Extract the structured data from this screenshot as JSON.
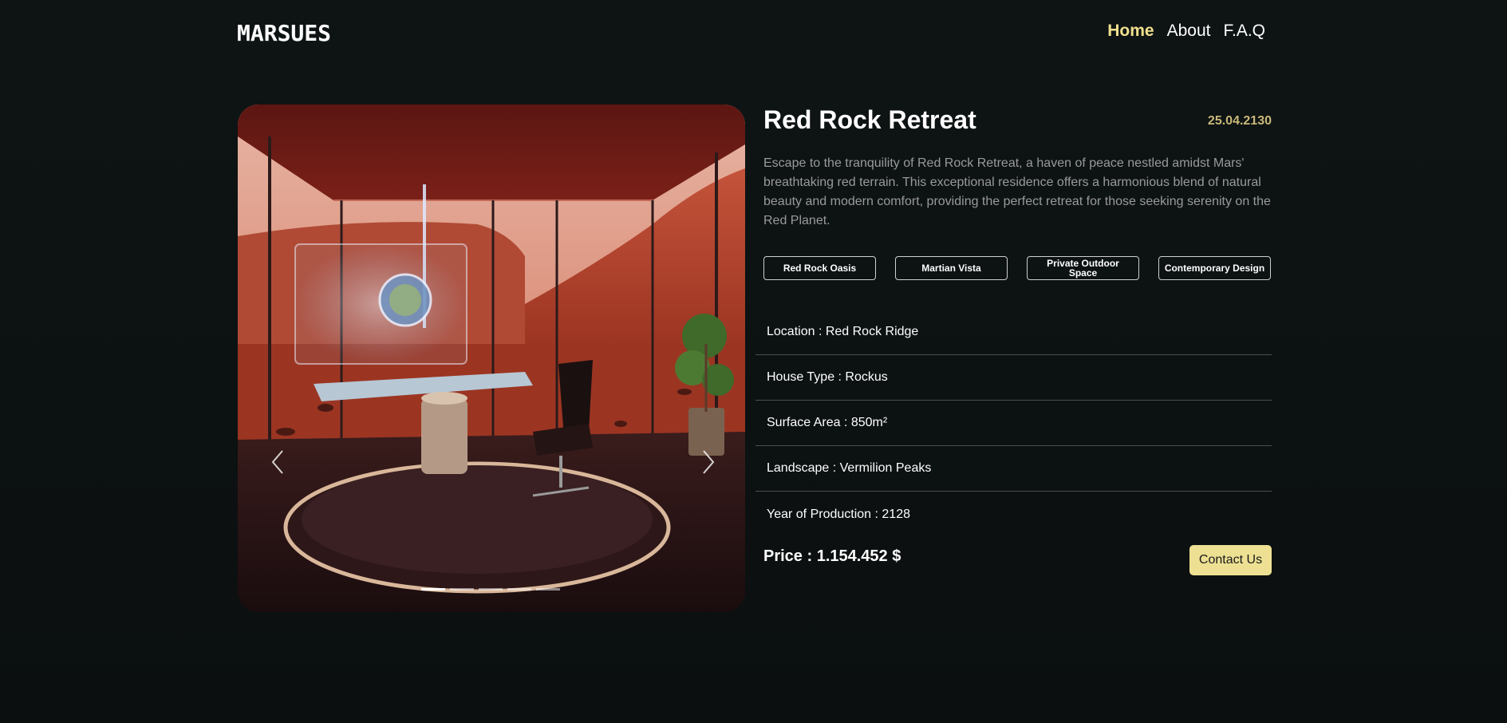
{
  "brand": {
    "logo_text": "MARSUES"
  },
  "nav": {
    "items": [
      {
        "label": "Home",
        "active": true
      },
      {
        "label": "About",
        "active": false
      },
      {
        "label": "F.A.Q",
        "active": false
      }
    ]
  },
  "property": {
    "title": "Red Rock Retreat",
    "date": "25.04.2130",
    "description": "Escape to the tranquility of Red Rock Retreat, a haven of peace nestled amidst Mars' breathtaking red terrain. This exceptional residence offers a harmonious blend of natural beauty and modern comfort, providing the perfect retreat for those seeking serenity on the Red Planet.",
    "tags": [
      "Red Rock Oasis",
      "Martian Vista",
      "Private Outdoor Space",
      "Contemporary Design"
    ],
    "specs": [
      "Location : Red Rock Ridge",
      "House Type : Rockus",
      "Surface Area : 850m²",
      "Landscape : Vermilion Peaks",
      "Year of Production : 2128"
    ],
    "price": "Price : 1.154.452 $",
    "contact_label": "Contact Us"
  },
  "carousel": {
    "slide_count": 5,
    "active_slide": 1,
    "prev_icon": "chevron-left-icon",
    "next_icon": "chevron-right-icon"
  },
  "colors": {
    "background": "#0e1414",
    "accent": "#ede093",
    "nav_active": "#f0e08e",
    "date": "#c9b87a",
    "description": "#9a9a9a"
  }
}
